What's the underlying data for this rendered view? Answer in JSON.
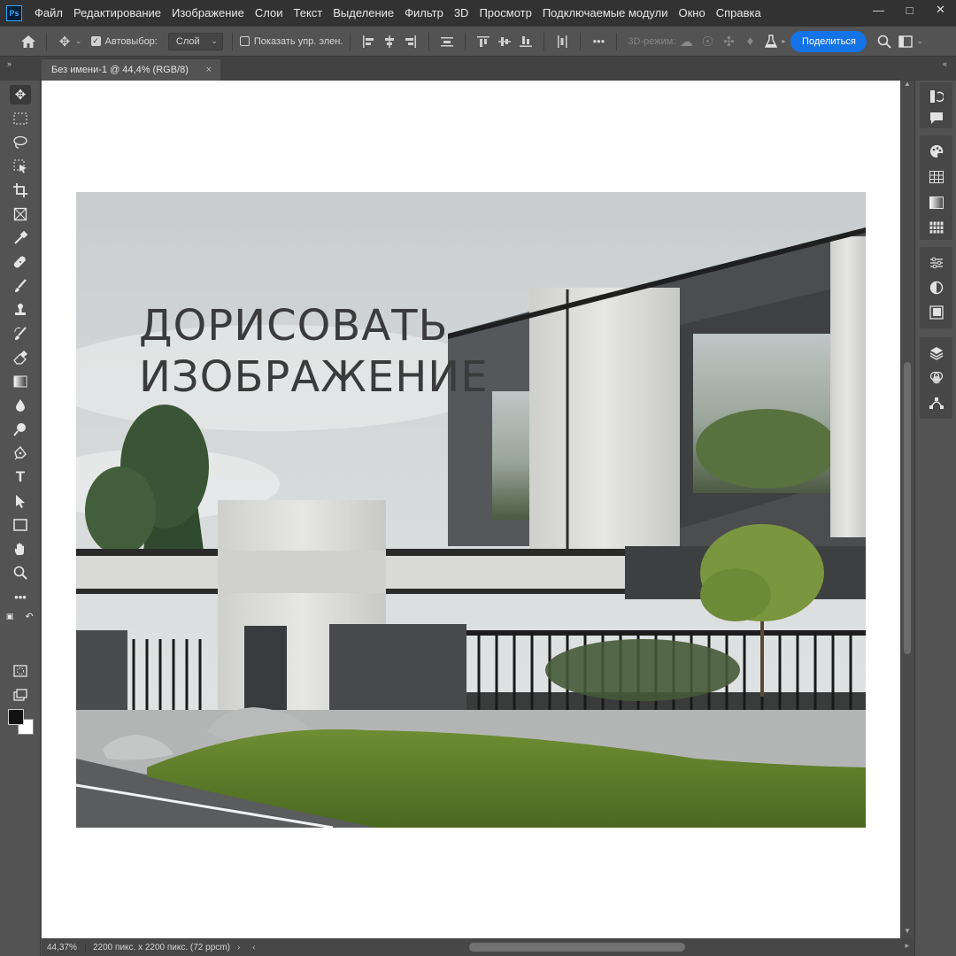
{
  "menu": {
    "logo": "Ps",
    "items": [
      "Файл",
      "Редактирование",
      "Изображение",
      "Слои",
      "Текст",
      "Выделение",
      "Фильтр",
      "3D",
      "Просмотр",
      "Подключаемые модули",
      "Окно",
      "Справка"
    ]
  },
  "options": {
    "autoselect_label": "Автовыбор:",
    "autoselect_value": "Слой",
    "show_transform_label": "Показать упр. элен.",
    "mode3d_label": "3D-режим:",
    "more_label": "•••",
    "share_label": "Поделиться"
  },
  "document": {
    "tab_title": "Без имени-1 @ 44,4% (RGB/8)",
    "close_glyph": "×"
  },
  "artwork": {
    "headline_line1": "ДОРИСОВАТЬ",
    "headline_line2": "ИЗОБРАЖЕНИЕ"
  },
  "status": {
    "zoom": "44,37%",
    "doc_info": "2200 пикс. x 2200 пикс. (72 ppcm)"
  },
  "colors": {
    "accent": "#1473e6",
    "foreground": "#111111",
    "background": "#ffffff"
  }
}
